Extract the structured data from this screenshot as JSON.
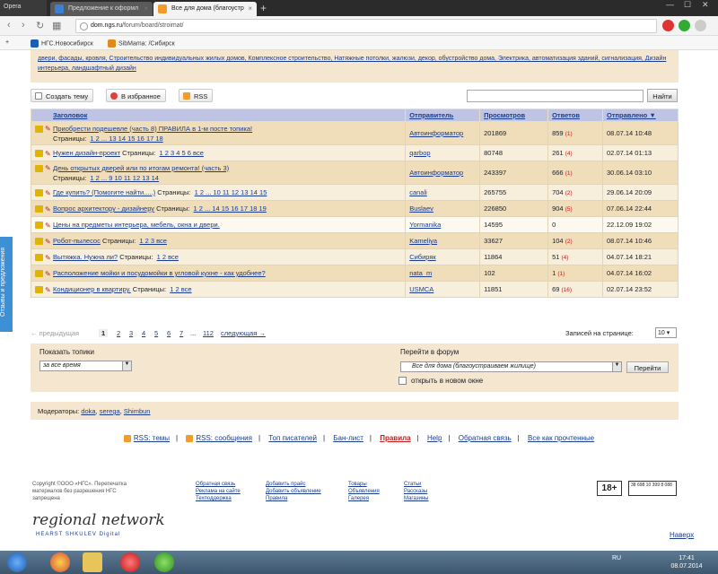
{
  "browser": {
    "app_name": "Opera",
    "tabs": [
      {
        "label": "Предложение к оформл"
      },
      {
        "label": "Все для дома (благоустр"
      }
    ],
    "url_host": "dom.ngs.ru",
    "url_path": "/forum/board/stroimat/",
    "bookmarks": [
      {
        "label": "НГС.Новосибирск"
      },
      {
        "label": "SibMama: /Сибирск"
      }
    ]
  },
  "categories_text": "двери, фасады, кровля, Строительство индивидуальных жилых домов, Комплексное строительство, Натяжные потолки, жалюзи, декор, обустройство дома, Электрика, автоматизация зданий, сигнализация, Дизайн интерьера, ландшафтный дизайн",
  "actions": {
    "create_topic": "Создать тему",
    "favorites": "В избранное",
    "rss": "RSS",
    "search_button": "Найти"
  },
  "table": {
    "headers": {
      "title": "Заголовок",
      "author": "Отправитель",
      "views": "Просмотров",
      "replies": "Ответов",
      "sent": "Отправлено ▼"
    },
    "pages_label": "Страницы:",
    "rows": [
      {
        "title": "Приобрести подешевле (часть 8) ПРАВИЛА в 1-м посте топика!",
        "pages": "1 2 ... 13 14 15 16 17 18",
        "author": "Автоинформатор",
        "views": "201869",
        "replies": "859",
        "new": "(1)",
        "sent": "08.07.14 10:48",
        "style": "r1",
        "two_line": true,
        "icon": "#e0b400"
      },
      {
        "title": "Нужен дизайн-проект",
        "pages": "1 2 3 4 5 6 все",
        "author": "qarbop",
        "views": "80748",
        "replies": "261",
        "new": "(4)",
        "sent": "02.07.14 01:13",
        "style": "r2",
        "two_line": false,
        "icon": "#e0b400"
      },
      {
        "title": "День открытых дверей или по итогам ремонта! (часть 3)",
        "pages": "1 2 ... 9 10 11 12 13 14",
        "author": "Автоинформатор",
        "views": "243397",
        "replies": "666",
        "new": "(1)",
        "sent": "30.06.14 03:10",
        "style": "r1",
        "two_line": true,
        "icon": "#e0b400"
      },
      {
        "title": "Где купить? (Помогите найти.....)",
        "pages": "1 2 ... 10 11 12 13 14 15",
        "author": "canali",
        "views": "265755",
        "replies": "704",
        "new": "(2)",
        "sent": "29.06.14 20:09",
        "style": "r2",
        "two_line": false,
        "icon": "#e0b400"
      },
      {
        "title": "Вопрос архитектору - дизайнеру",
        "pages": "1 2 ... 14 15 16 17 18 19",
        "author": "Buslaev",
        "views": "226850",
        "replies": "904",
        "new": "(5)",
        "sent": "07.06.14 22:44",
        "style": "r1",
        "two_line": false,
        "icon": "#e0b400"
      },
      {
        "title": "Цены на предметы интерьера, мебель, окна и двери.",
        "pages": "",
        "author": "Yormanika",
        "views": "14595",
        "replies": "0",
        "new": "",
        "sent": "22.12.09 19:02",
        "style": "rw",
        "two_line": false,
        "icon": "#e0b400"
      },
      {
        "title": "Робот-пылесос",
        "pages": "1 2 3 все",
        "author": "Kameliya",
        "views": "33627",
        "replies": "104",
        "new": "(2)",
        "sent": "08.07.14 10:46",
        "style": "r1",
        "two_line": false,
        "icon": "#e0b400"
      },
      {
        "title": "Вытяжка. Нужна ли?",
        "pages": "1 2 все",
        "author": "Сибиряк",
        "views": "11864",
        "replies": "51",
        "new": "(4)",
        "sent": "04.07.14 18:21",
        "style": "r2",
        "two_line": false,
        "icon": "#e0b400"
      },
      {
        "title": "Расположение мойки и посудомойки в угловой кухне - как удобнее?",
        "pages": "",
        "author": "nata_m",
        "views": "102",
        "replies": "1",
        "new": "(1)",
        "sent": "04.07.14 16:02",
        "style": "r1",
        "two_line": false,
        "icon": "#e0b400"
      },
      {
        "title": "Кондиционер в квартиру.",
        "pages": "1 2 все",
        "author": "USMCA",
        "views": "11851",
        "replies": "69",
        "new": "(16)",
        "sent": "02.07.14 23:52",
        "style": "r2",
        "two_line": false,
        "icon": "#e0b400"
      }
    ]
  },
  "pager": {
    "prev": "← предыдущая",
    "pages": [
      "1",
      "2",
      "3",
      "4",
      "5",
      "6",
      "7",
      "...",
      "112"
    ],
    "next": "следующая →",
    "per_page_label": "Записей на странице:",
    "per_page_value": "10"
  },
  "filters": {
    "show_label": "Показать топики",
    "show_value": "за все время",
    "goto_label": "Перейти в форум",
    "goto_value": "Все для дома (благоустраиваем жилище)",
    "goto_button": "Перейти",
    "new_window_label": "открыть в новом окне"
  },
  "moderators": {
    "label": "Модераторы:",
    "names": [
      "doka",
      "serega",
      "Shimbun"
    ]
  },
  "footer_links": [
    "RSS: темы",
    "RSS: сообщения",
    "Топ писателей",
    "Бан-лист",
    "Правила",
    "Help",
    "Обратная связь",
    "Все как прочтенные"
  ],
  "copyright": "Copyright ©ООО «НГС». Перепечатка материалов без разрешения НГС запрещена",
  "footer_columns": [
    [
      "Обратная связь",
      "Реклама на сайте",
      "Техподдержка"
    ],
    [
      "Добавить прайс",
      "Добавить объявление",
      "Правила"
    ],
    [
      "Товары",
      "Объявления",
      "Галерея"
    ],
    [
      "Статьи",
      "Рассказы",
      "Магазины"
    ]
  ],
  "rating": "18+",
  "counter": "38 698 10 399 8 088",
  "logo": "regional network",
  "logo_sub": "HEARST SHKULEV Digital",
  "back_to_top": "Наверх",
  "sidebar_tab": "Отзывы и предложения",
  "taskbar": {
    "lang": "RU",
    "time": "17:41",
    "date": "08.07.2014"
  }
}
